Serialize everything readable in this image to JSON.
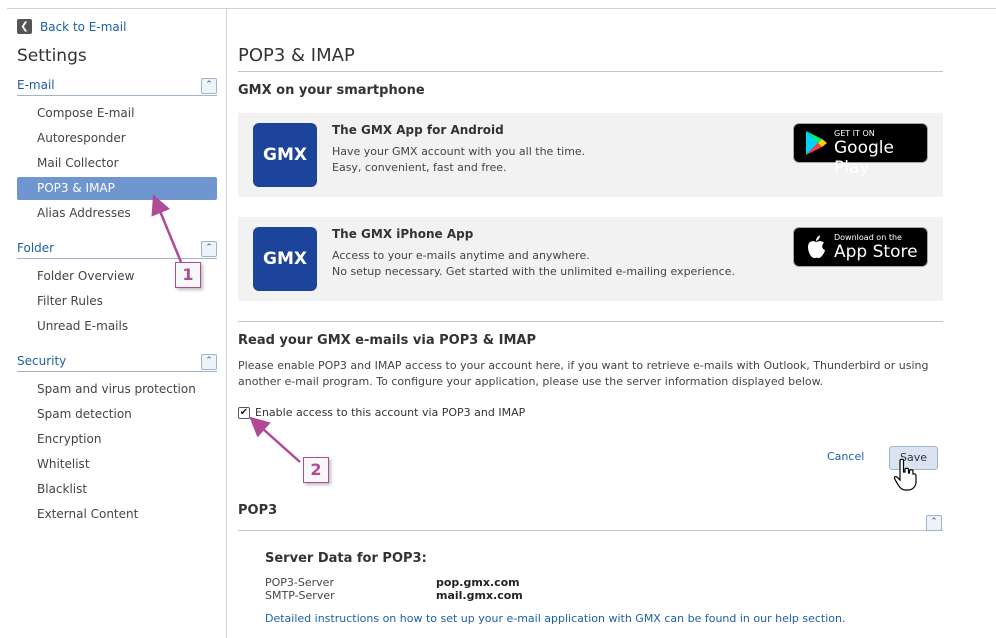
{
  "back_label": "Back to E-mail",
  "settings_title": "Settings",
  "sidebar": {
    "sections": [
      {
        "label": "E-mail",
        "items": [
          "Compose E-mail",
          "Autoresponder",
          "Mail Collector",
          "POP3 & IMAP",
          "Alias Addresses"
        ]
      },
      {
        "label": "Folder",
        "items": [
          "Folder Overview",
          "Filter Rules",
          "Unread E-mails"
        ]
      },
      {
        "label": "Security",
        "items": [
          "Spam and virus protection",
          "Spam detection",
          "Encryption",
          "Whitelist",
          "Blacklist",
          "External Content"
        ]
      }
    ],
    "active_item": "POP3 & IMAP"
  },
  "main": {
    "title": "POP3 & IMAP",
    "smartphone_heading": "GMX on your smartphone",
    "android": {
      "logo": "GMX",
      "title": "The GMX App for Android",
      "line1": "Have your GMX account with you all the time.",
      "line2": "Easy, convenient, fast and free.",
      "badge_small": "GET IT ON",
      "badge_big": "Google Play"
    },
    "iphone": {
      "logo": "GMX",
      "title": "The GMX iPhone App",
      "line1": "Access to your e-mails anytime and anywhere.",
      "line2": "No setup necessary. Get started with the unlimited e-mailing experience.",
      "badge_small": "Download on the",
      "badge_big": "App Store"
    },
    "read_heading": "Read your GMX e-mails via POP3 & IMAP",
    "read_para": "Please enable POP3 and IMAP access to your account here, if you want to retrieve e-mails with Outlook, Thunderbird or using another e-mail program. To configure your application, please use the server information displayed below.",
    "enable_label": "Enable access to this account via POP3 and IMAP",
    "enable_checked": true,
    "cancel_label": "Cancel",
    "save_label": "Save",
    "pop3_heading": "POP3",
    "server_title": "Server Data for POP3:",
    "pop3_server_label": "POP3-Server",
    "pop3_server_value": "pop.gmx.com",
    "smtp_server_label": "SMTP-Server",
    "smtp_server_value": "mail.gmx.com",
    "help_text": "Detailed instructions on how to set up your e-mail application with GMX can be found in our help section."
  },
  "callouts": [
    "1",
    "2"
  ],
  "colors": {
    "accent": "#1f5fa6",
    "active_item": "#6f96cf",
    "gmx_blue": "#1c449b",
    "callout": "#b04a97"
  }
}
